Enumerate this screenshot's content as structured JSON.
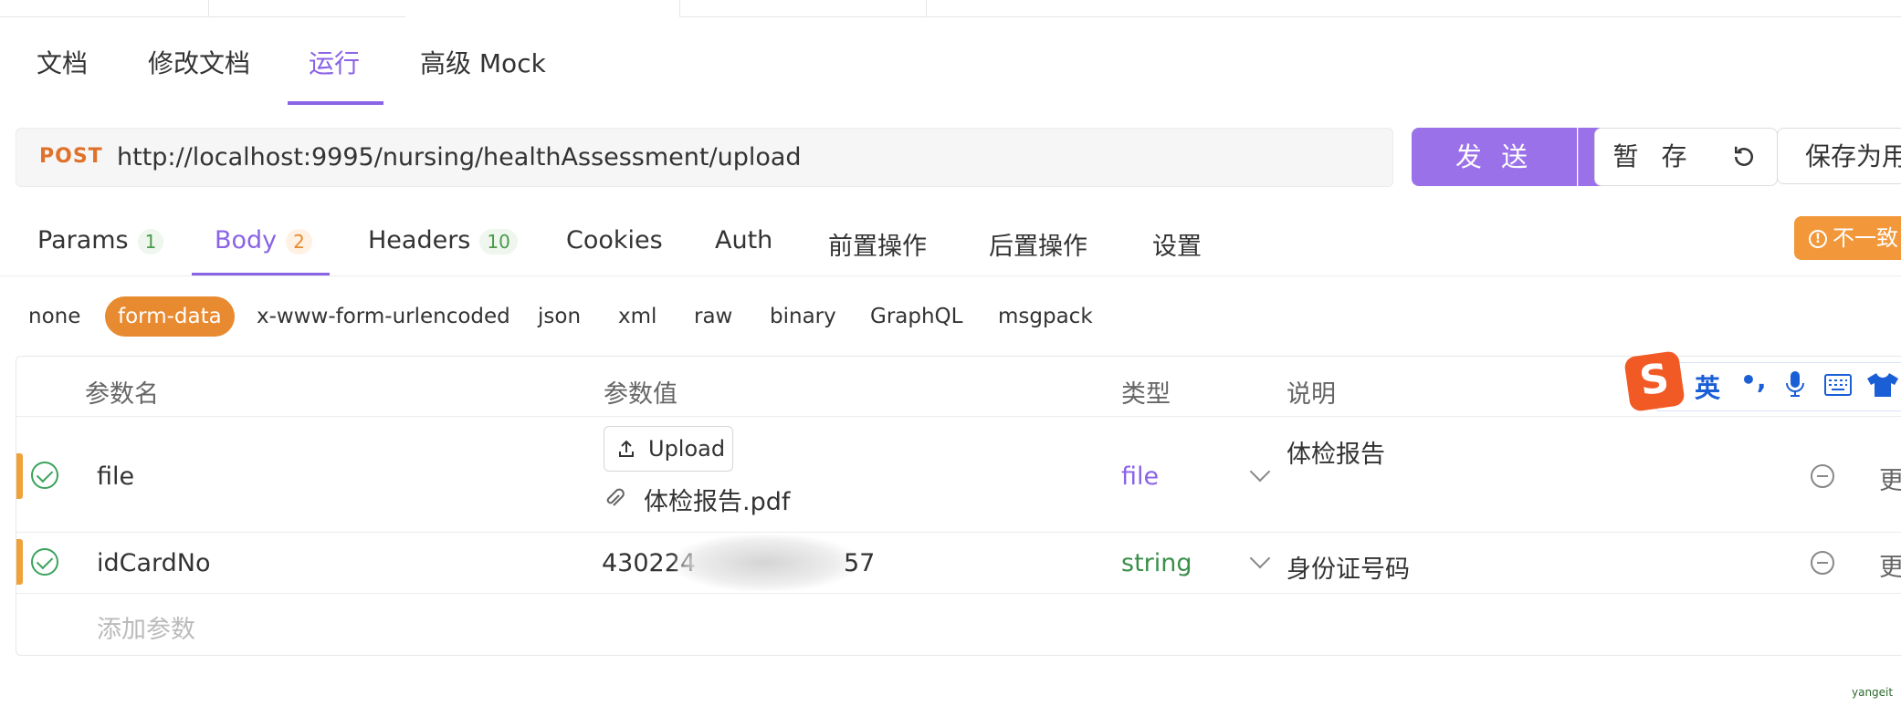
{
  "main_tabs": [
    {
      "label": "文档"
    },
    {
      "label": "修改文档"
    },
    {
      "label": "运行",
      "active": true
    },
    {
      "label": "高级 Mock"
    }
  ],
  "request": {
    "method": "POST",
    "url": "http://localhost:9995/nursing/healthAssessment/upload",
    "send_label": "发 送",
    "temp_save_label": "暂 存",
    "save_as_label": "保存为用"
  },
  "sub_tabs": [
    {
      "label": "Params",
      "badge": "1"
    },
    {
      "label": "Body",
      "badge": "2",
      "active": true
    },
    {
      "label": "Headers",
      "badge": "10"
    },
    {
      "label": "Cookies"
    },
    {
      "label": "Auth"
    },
    {
      "label": "前置操作"
    },
    {
      "label": "后置操作"
    },
    {
      "label": "设置"
    }
  ],
  "mismatch_label": "不一致",
  "body_types": [
    "none",
    "form-data",
    "x-www-form-urlencoded",
    "json",
    "xml",
    "raw",
    "binary",
    "GraphQL",
    "msgpack"
  ],
  "active_body_type": "form-data",
  "table": {
    "headers": {
      "name": "参数名",
      "value": "参数值",
      "type": "类型",
      "desc": "说明"
    },
    "rows": [
      {
        "name": "file",
        "upload_label": "Upload",
        "file_name": "体检报告.pdf",
        "type": "file",
        "desc": "体检报告",
        "more": "更"
      },
      {
        "name": "idCardNo",
        "value_prefix": "430224",
        "value_suffix": "57",
        "type": "string",
        "desc": "身份证号码",
        "more": "更"
      }
    ],
    "add_placeholder": "添加参数"
  },
  "ime": {
    "lang": "英",
    "punct": "•,",
    "logo": "S"
  },
  "watermark": "yangeit",
  "colors": {
    "accent": "#8a63e6",
    "method": "#e0712b",
    "send": "#9b71ea",
    "active_body": "#e88a30",
    "mismatch": "#f2983b"
  }
}
